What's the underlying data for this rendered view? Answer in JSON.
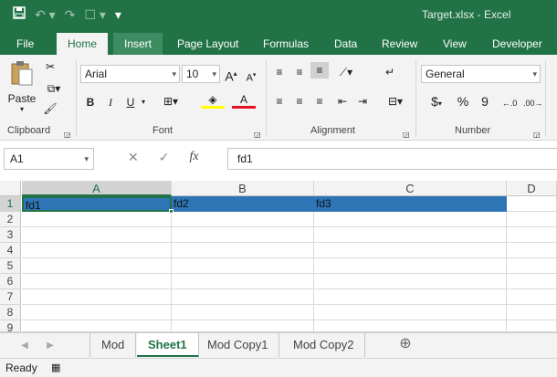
{
  "window": {
    "title": "Target.xlsx - Excel"
  },
  "quick_access": [
    "save-icon",
    "undo-icon",
    "redo-icon",
    "touch-mode-icon",
    "customize-icon"
  ],
  "menu_tabs": [
    {
      "label": "File"
    },
    {
      "label": "Home"
    },
    {
      "label": "Insert"
    },
    {
      "label": "Page Layout"
    },
    {
      "label": "Formulas"
    },
    {
      "label": "Data"
    },
    {
      "label": "Review"
    },
    {
      "label": "View"
    },
    {
      "label": "Developer"
    }
  ],
  "ribbon": {
    "clipboard": {
      "paste_label": "Paste",
      "group_label": "Clipboard"
    },
    "font": {
      "font_name": "Arial",
      "font_size": "10",
      "bold": "B",
      "italic": "I",
      "underline": "U",
      "group_label": "Font"
    },
    "alignment": {
      "group_label": "Alignment"
    },
    "number": {
      "format": "General",
      "currency": "$",
      "percent": "%",
      "comma": "9",
      "group_label": "Number"
    }
  },
  "formula_bar": {
    "name_box": "A1",
    "fx_label": "fx",
    "value": "fd1"
  },
  "columns": [
    {
      "label": "A"
    },
    {
      "label": "B"
    },
    {
      "label": "C"
    },
    {
      "label": "D"
    }
  ],
  "rows": [
    "1",
    "2",
    "3",
    "4",
    "5",
    "6",
    "7",
    "8",
    "9"
  ],
  "cells": {
    "A1": "fd1",
    "B1": "fd2",
    "C1": "fd3"
  },
  "sheets": [
    {
      "label": "Mod"
    },
    {
      "label": "Sheet1"
    },
    {
      "label": "Mod Copy1"
    },
    {
      "label": "Mod Copy2"
    }
  ],
  "status": {
    "text": "Ready"
  },
  "colors": {
    "brand": "#217346",
    "selection": "#2e75b6"
  }
}
